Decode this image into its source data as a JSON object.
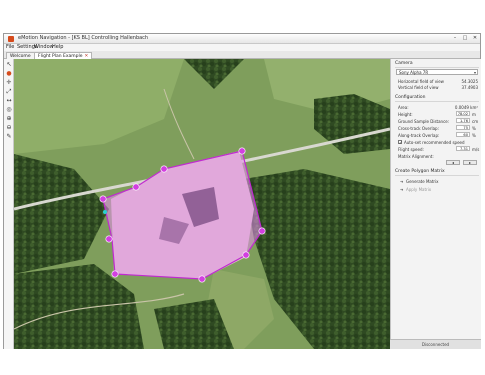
{
  "window": {
    "title": "eMotion Navigation - [KS BL] Controlling Hallenbach",
    "minimize": "–",
    "maximize": "□",
    "close": "✕"
  },
  "menu": [
    "File",
    "Settings",
    "Window",
    "Help"
  ],
  "tabs": [
    {
      "label": "Welcome",
      "active": false
    },
    {
      "label": "Flight Plan Example",
      "active": true,
      "close": "✕"
    }
  ],
  "tools": [
    "↖",
    "●",
    "✛",
    "⤢",
    "↔",
    "◎",
    "⊕",
    "⊖",
    "✎"
  ],
  "camera": {
    "section": "Camera",
    "selected": "Sony Alpha 7R",
    "fields": [
      {
        "label": "Horizontal field of view",
        "value": "54.3025"
      },
      {
        "label": "Vertical field of view",
        "value": "37.4903"
      }
    ]
  },
  "configuration": {
    "section": "Configuration",
    "area_label": "Area:",
    "area_value": "0.0049 km²",
    "inputs": [
      {
        "label": "Height:",
        "value": "78.02",
        "unit": "m"
      },
      {
        "label": "Ground Sample Distance:",
        "value": "1.76",
        "unit": "cm"
      },
      {
        "label": "Cross-track Overlap:",
        "value": "75",
        "unit": "%"
      },
      {
        "label": "Along-track Overlap:",
        "value": "60",
        "unit": "%"
      }
    ],
    "auto_speed_label": "Auto-set recommended speed",
    "auto_speed_checked": true,
    "flight_speed": {
      "label": "Flight speed:",
      "value": "7.31",
      "unit": "m/s"
    },
    "alignment_label": "Matrix Alignment:",
    "align_left": "◂",
    "align_right": "▸"
  },
  "polygon_matrix": {
    "section": "Create Polygon Matrix",
    "generate": "Generate Matrix",
    "apply": "Apply Matrix"
  },
  "status": "Disconnected",
  "colors": {
    "polygon_fill": "#e88ef0",
    "polygon_stroke": "#c02ad0",
    "vertex": "#d23fe0",
    "accent": "#d64b1c"
  }
}
